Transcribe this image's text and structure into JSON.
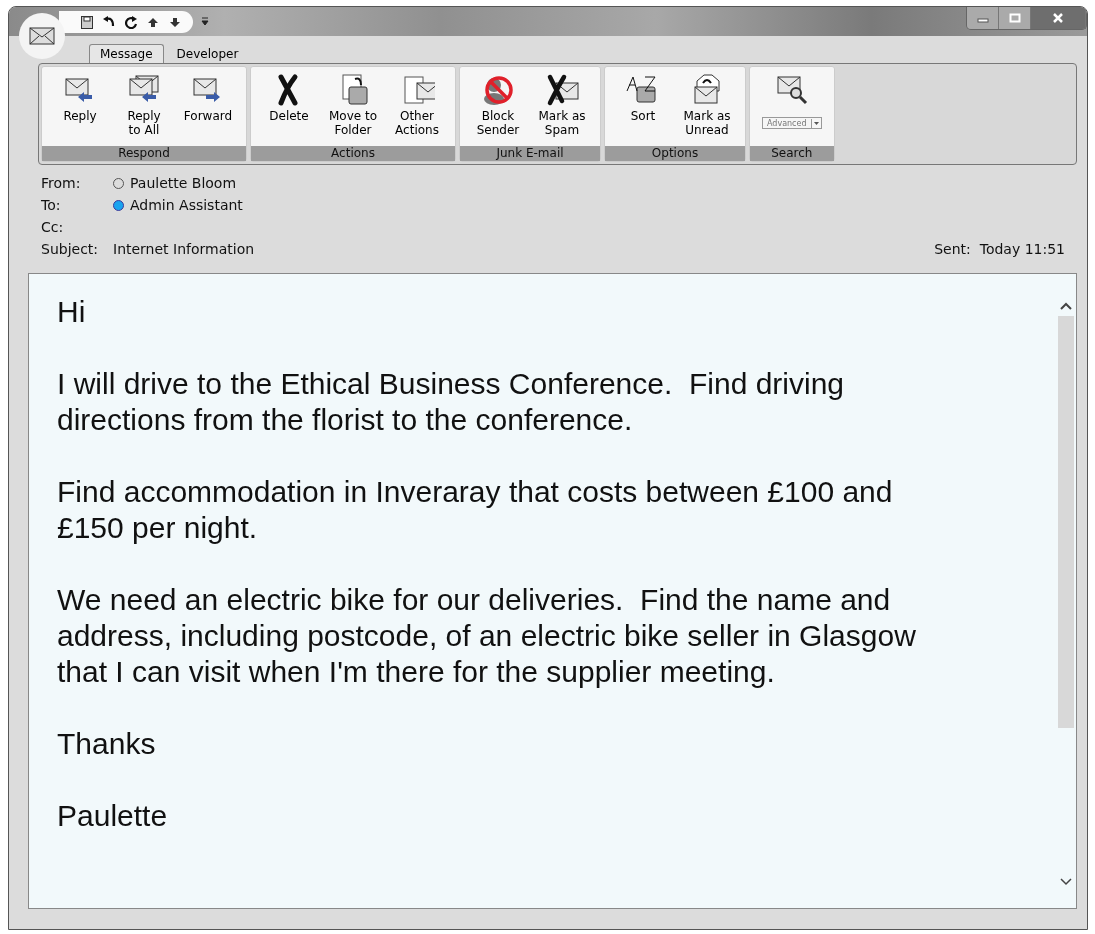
{
  "tabs": [
    {
      "label": "Message",
      "selected": true
    },
    {
      "label": "Developer",
      "selected": false
    }
  ],
  "ribbon": [
    {
      "label": "Respond",
      "buttons": [
        {
          "kind": "reply",
          "lines": [
            "Reply"
          ]
        },
        {
          "kind": "reply-all",
          "lines": [
            "Reply",
            "to All"
          ]
        },
        {
          "kind": "forward",
          "lines": [
            "Forward"
          ]
        }
      ]
    },
    {
      "label": "Actions",
      "buttons": [
        {
          "kind": "delete",
          "lines": [
            "Delete"
          ]
        },
        {
          "kind": "move",
          "lines": [
            "Move to",
            "Folder"
          ]
        },
        {
          "kind": "other",
          "lines": [
            "Other",
            "Actions"
          ]
        }
      ]
    },
    {
      "label": "Junk E-mail",
      "buttons": [
        {
          "kind": "block",
          "lines": [
            "Block",
            "Sender"
          ]
        },
        {
          "kind": "spam",
          "lines": [
            "Mark as",
            "Spam"
          ]
        }
      ]
    },
    {
      "label": "Options",
      "buttons": [
        {
          "kind": "sort",
          "lines": [
            "Sort"
          ]
        },
        {
          "kind": "unread",
          "lines": [
            "Mark as",
            "Unread"
          ]
        }
      ]
    },
    {
      "label": "Search",
      "buttons": [
        {
          "kind": "search",
          "dropdown": "Advanced"
        }
      ]
    }
  ],
  "header": {
    "from": {
      "label": "From:",
      "name": "Paulette Bloom",
      "online": false
    },
    "to": {
      "label": "To:",
      "name": "Admin Assistant",
      "online": true
    },
    "cc": {
      "label": "Cc:"
    },
    "subject": {
      "label": "Subject:",
      "value": "Internet Information"
    },
    "sent": {
      "label": "Sent:",
      "value": "Today 11:51"
    }
  },
  "body": [
    [
      "Hi"
    ],
    [
      "I will drive to the Ethical Business Conference.  Find driving",
      "directions from the florist to the conference."
    ],
    [
      "Find accommodation in Inveraray that costs between £100 and",
      "£150 per night."
    ],
    [
      "We need an electric bike for our deliveries.  Find the name and",
      "address, including postcode, of an electric bike seller in Glasgow",
      "that I can visit when I'm there for the supplier meeting."
    ],
    [
      "Thanks"
    ],
    [
      "Paulette"
    ]
  ]
}
